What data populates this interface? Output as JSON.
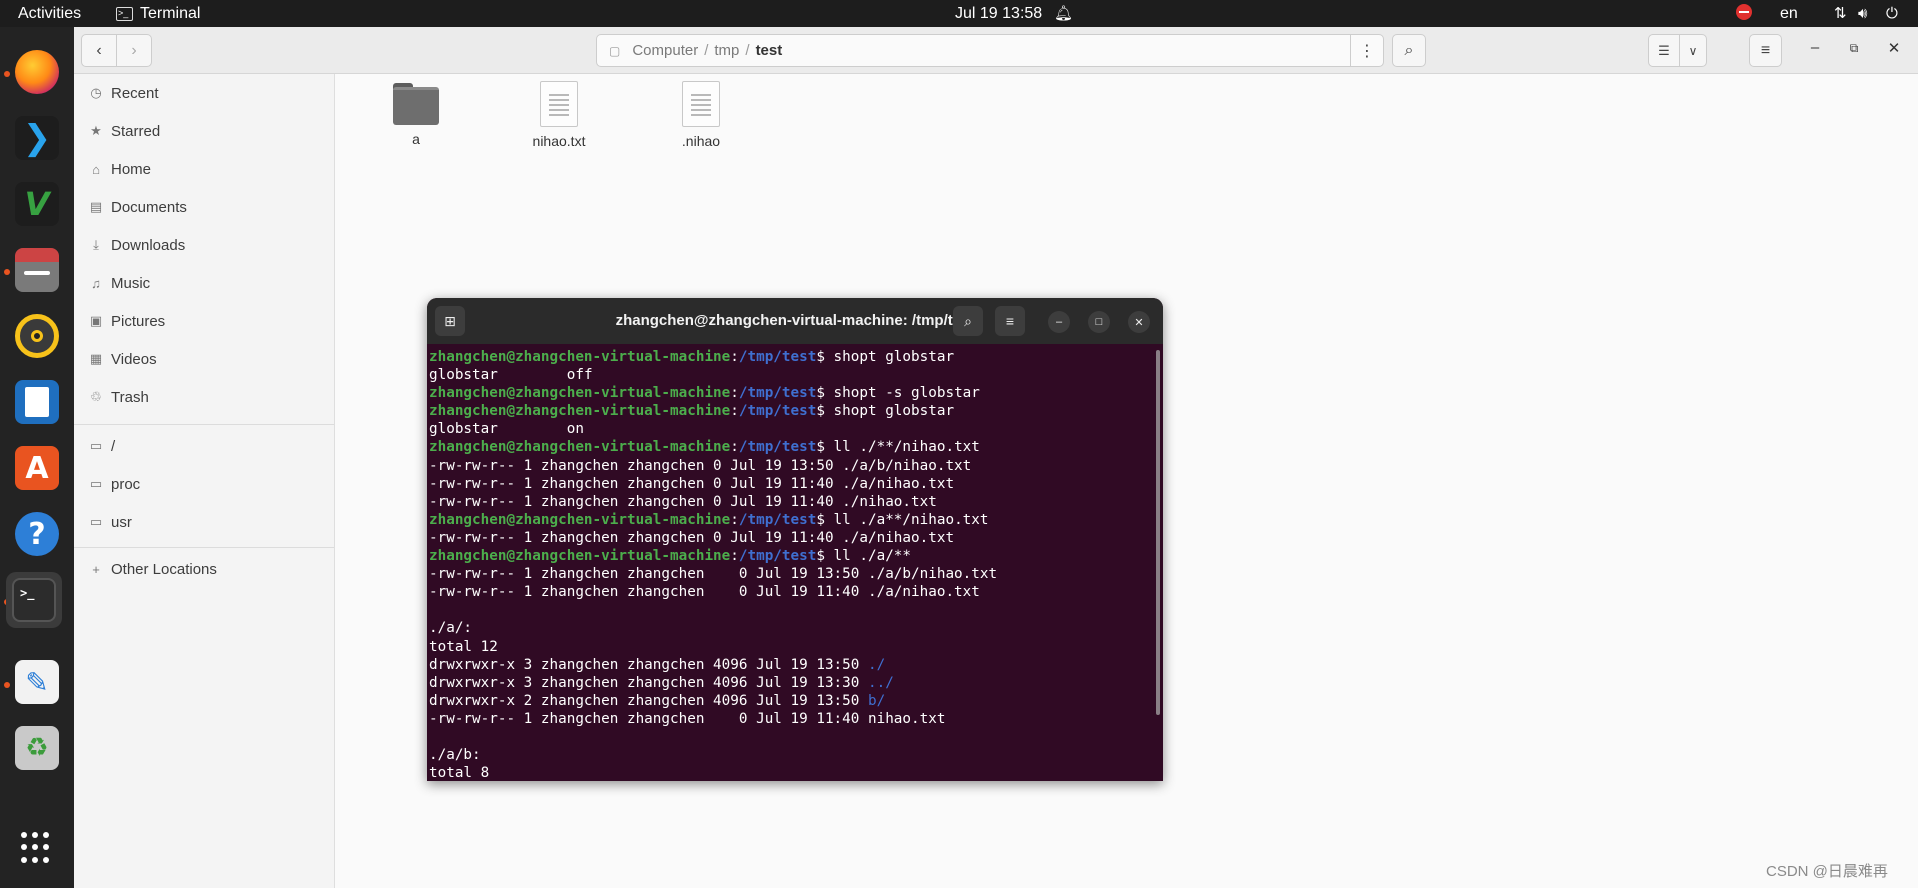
{
  "topbar": {
    "activities": "Activities",
    "app_name": "Terminal",
    "clock": "Jul 19  13:58",
    "lang": "en"
  },
  "files": {
    "path": [
      "Computer",
      "tmp",
      "test"
    ],
    "sidebar": {
      "places": [
        "Recent",
        "Starred",
        "Home",
        "Documents",
        "Downloads",
        "Music",
        "Pictures",
        "Videos",
        "Trash"
      ],
      "devices": [
        "/",
        "proc",
        "usr"
      ],
      "other": "Other Locations"
    },
    "items": [
      {
        "name": "a",
        "type": "folder"
      },
      {
        "name": "nihao.txt",
        "type": "text"
      },
      {
        "name": ".nihao",
        "type": "text"
      }
    ]
  },
  "terminal": {
    "title": "zhangchen@zhangchen-virtual-machine: /tmp/test",
    "prompt_user": "zhangchen@zhangchen-virtual-machine",
    "prompt_path": "/tmp/test",
    "lines": [
      {
        "kind": "cmd",
        "text": "shopt globstar"
      },
      {
        "kind": "out",
        "text": "globstar       \toff"
      },
      {
        "kind": "cmd",
        "text": "shopt -s globstar"
      },
      {
        "kind": "cmd",
        "text": "shopt globstar"
      },
      {
        "kind": "out",
        "text": "globstar       \ton"
      },
      {
        "kind": "cmd",
        "text": "ll ./**/nihao.txt"
      },
      {
        "kind": "out",
        "text": "-rw-rw-r-- 1 zhangchen zhangchen 0 Jul 19 13:50 ./a/b/nihao.txt"
      },
      {
        "kind": "out",
        "text": "-rw-rw-r-- 1 zhangchen zhangchen 0 Jul 19 11:40 ./a/nihao.txt"
      },
      {
        "kind": "out",
        "text": "-rw-rw-r-- 1 zhangchen zhangchen 0 Jul 19 11:40 ./nihao.txt"
      },
      {
        "kind": "cmd",
        "text": "ll ./a**/nihao.txt"
      },
      {
        "kind": "out",
        "text": "-rw-rw-r-- 1 zhangchen zhangchen 0 Jul 19 11:40 ./a/nihao.txt"
      },
      {
        "kind": "cmd",
        "text": "ll ./a/**"
      },
      {
        "kind": "out",
        "text": "-rw-rw-r-- 1 zhangchen zhangchen    0 Jul 19 13:50 ./a/b/nihao.txt"
      },
      {
        "kind": "out",
        "text": "-rw-rw-r-- 1 zhangchen zhangchen    0 Jul 19 11:40 ./a/nihao.txt"
      },
      {
        "kind": "out",
        "text": ""
      },
      {
        "kind": "out",
        "text": "./a/:"
      },
      {
        "kind": "out",
        "text": "total 12"
      },
      {
        "kind": "dir",
        "text": "drwxrwxr-x 3 zhangchen zhangchen 4096 Jul 19 13:50 ",
        "dir": "./"
      },
      {
        "kind": "dir",
        "text": "drwxrwxr-x 3 zhangchen zhangchen 4096 Jul 19 13:30 ",
        "dir": "../"
      },
      {
        "kind": "dir",
        "text": "drwxrwxr-x 2 zhangchen zhangchen 4096 Jul 19 13:50 ",
        "dir": "b/"
      },
      {
        "kind": "out",
        "text": "-rw-rw-r-- 1 zhangchen zhangchen    0 Jul 19 11:40 nihao.txt"
      },
      {
        "kind": "out",
        "text": ""
      },
      {
        "kind": "out",
        "text": "./a/b:"
      },
      {
        "kind": "out",
        "text": "total 8"
      }
    ]
  },
  "watermark": "CSDN @日晨难再"
}
